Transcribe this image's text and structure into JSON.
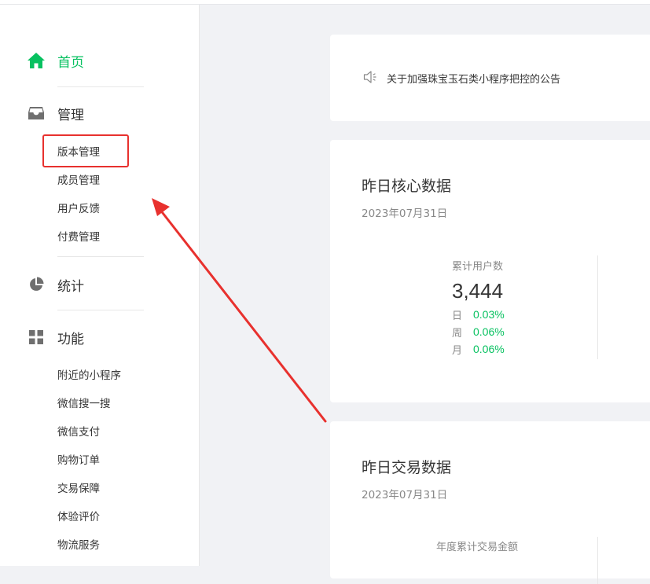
{
  "sidebar": {
    "home": {
      "label": "首页",
      "icon": "home-icon"
    },
    "manage": {
      "label": "管理",
      "icon": "inbox-icon",
      "items": [
        "版本管理",
        "成员管理",
        "用户反馈",
        "付费管理"
      ]
    },
    "stats": {
      "label": "统计",
      "icon": "pie-chart-icon"
    },
    "features": {
      "label": "功能",
      "icon": "grid-icon",
      "items": [
        "附近的小程序",
        "微信搜一搜",
        "微信支付",
        "购物订单",
        "交易保障",
        "体验评价",
        "物流服务"
      ]
    }
  },
  "notice": {
    "text": "关于加强珠宝玉石类小程序把控的公告",
    "icon": "speaker-icon"
  },
  "core": {
    "title": "昨日核心数据",
    "date": "2023年07月31日",
    "metric_label": "累计用户数",
    "metric_value": "3,444",
    "trends": [
      {
        "key": "日",
        "value": "0.03%"
      },
      {
        "key": "周",
        "value": "0.06%"
      },
      {
        "key": "月",
        "value": "0.06%"
      }
    ]
  },
  "trade": {
    "title": "昨日交易数据",
    "date": "2023年07月31日",
    "metric_label": "年度累计交易金额"
  },
  "colors": {
    "accent": "#07c160",
    "annotation": "#e8312e"
  }
}
